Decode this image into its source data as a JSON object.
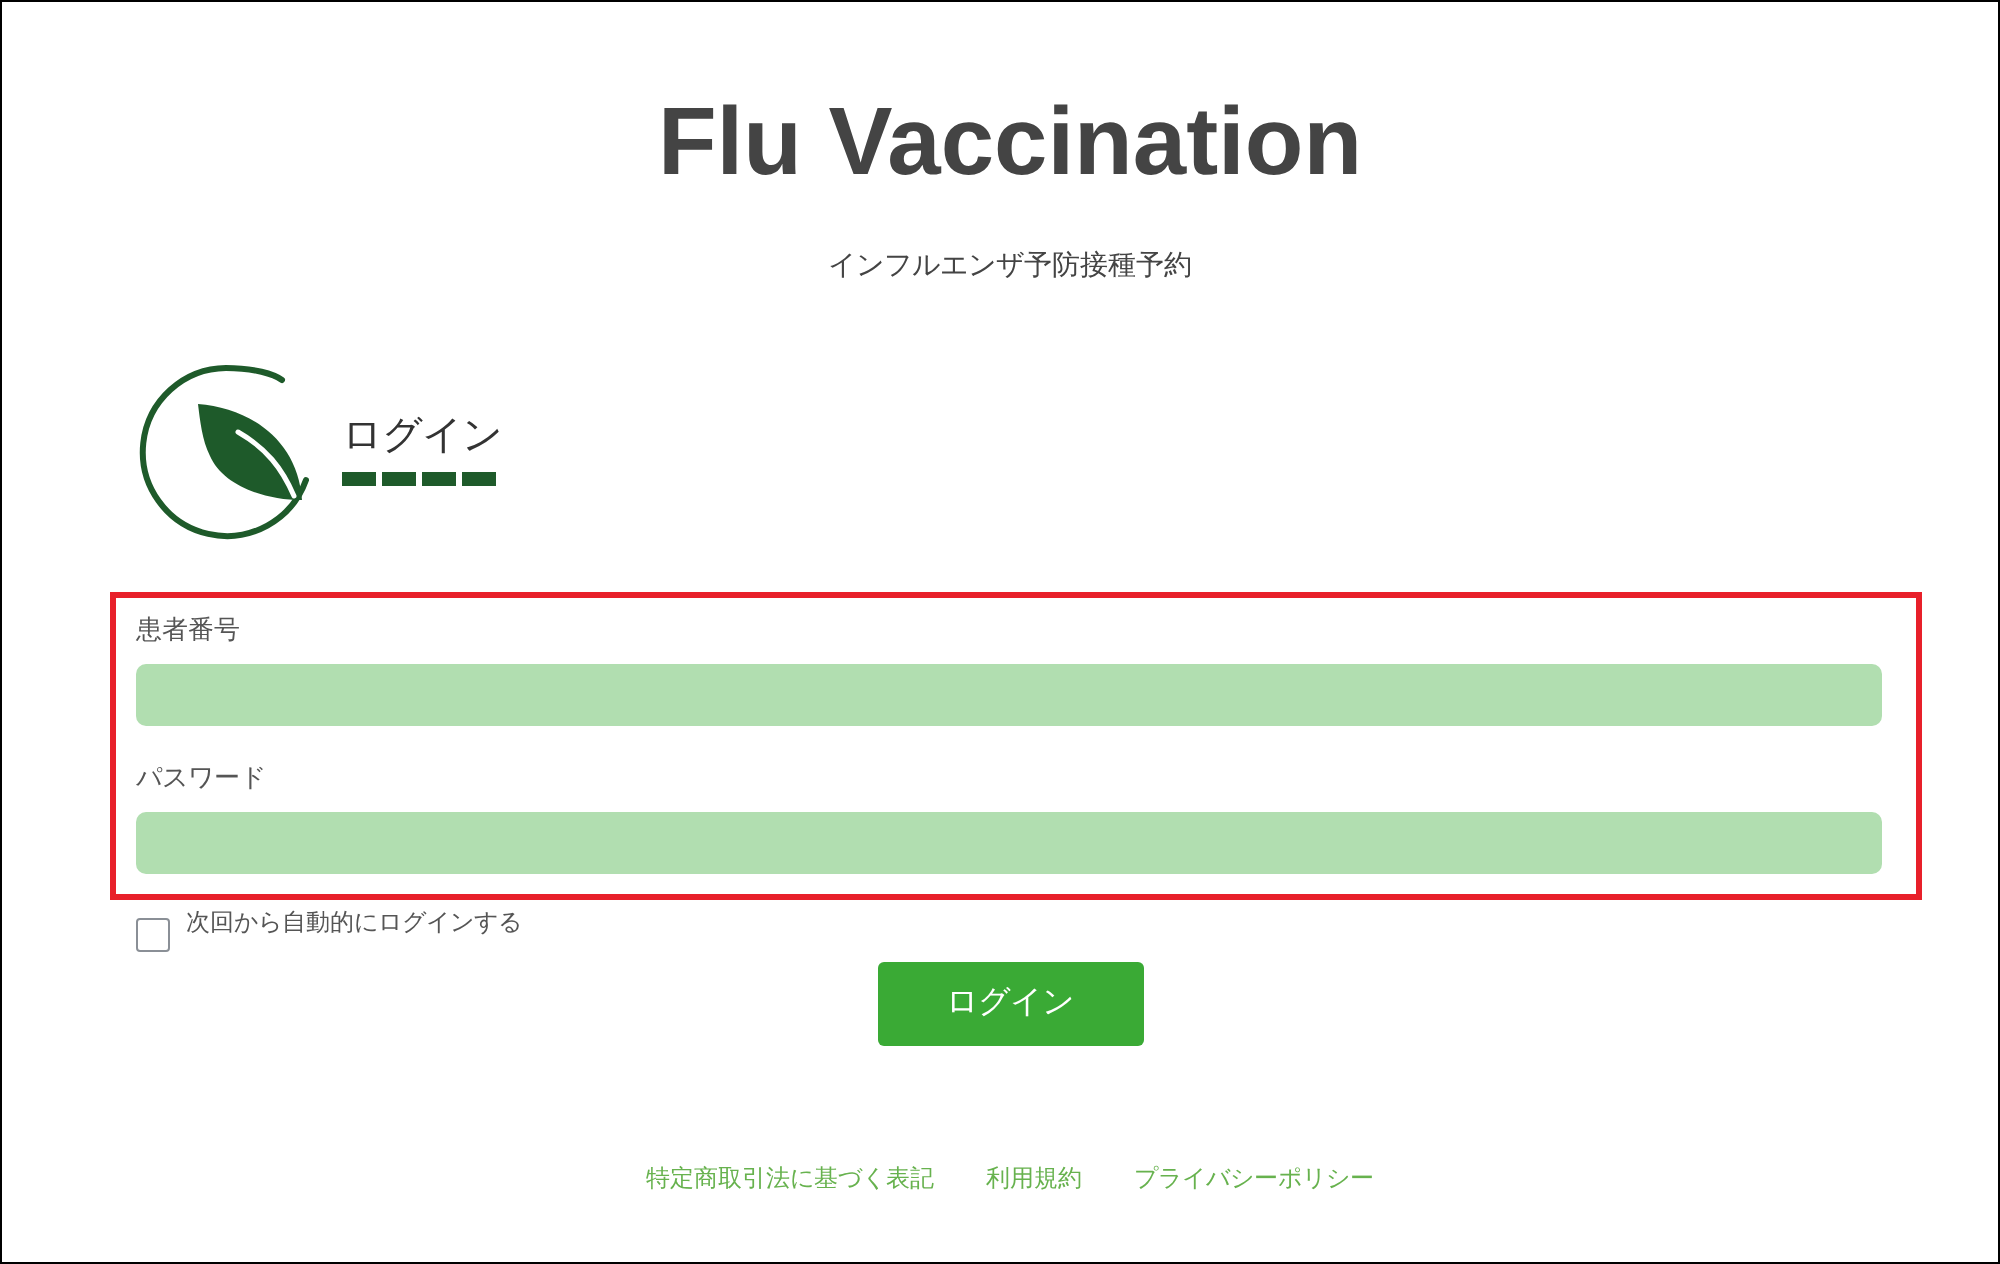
{
  "header": {
    "title": "Flu Vaccination",
    "subtitle": "インフルエンザ予防接種予約"
  },
  "login_section": {
    "heading": "ログイン"
  },
  "form": {
    "highlighted": true,
    "fields": [
      {
        "label": "患者番号"
      },
      {
        "label": "パスワード"
      }
    ]
  },
  "remember_me": {
    "label": "次回から自動的にログインする",
    "checked": false
  },
  "submit_button": "ログイン",
  "footer_links": [
    "特定商取引法に基づく表記",
    "利用規約",
    "プライバシーポリシー"
  ]
}
